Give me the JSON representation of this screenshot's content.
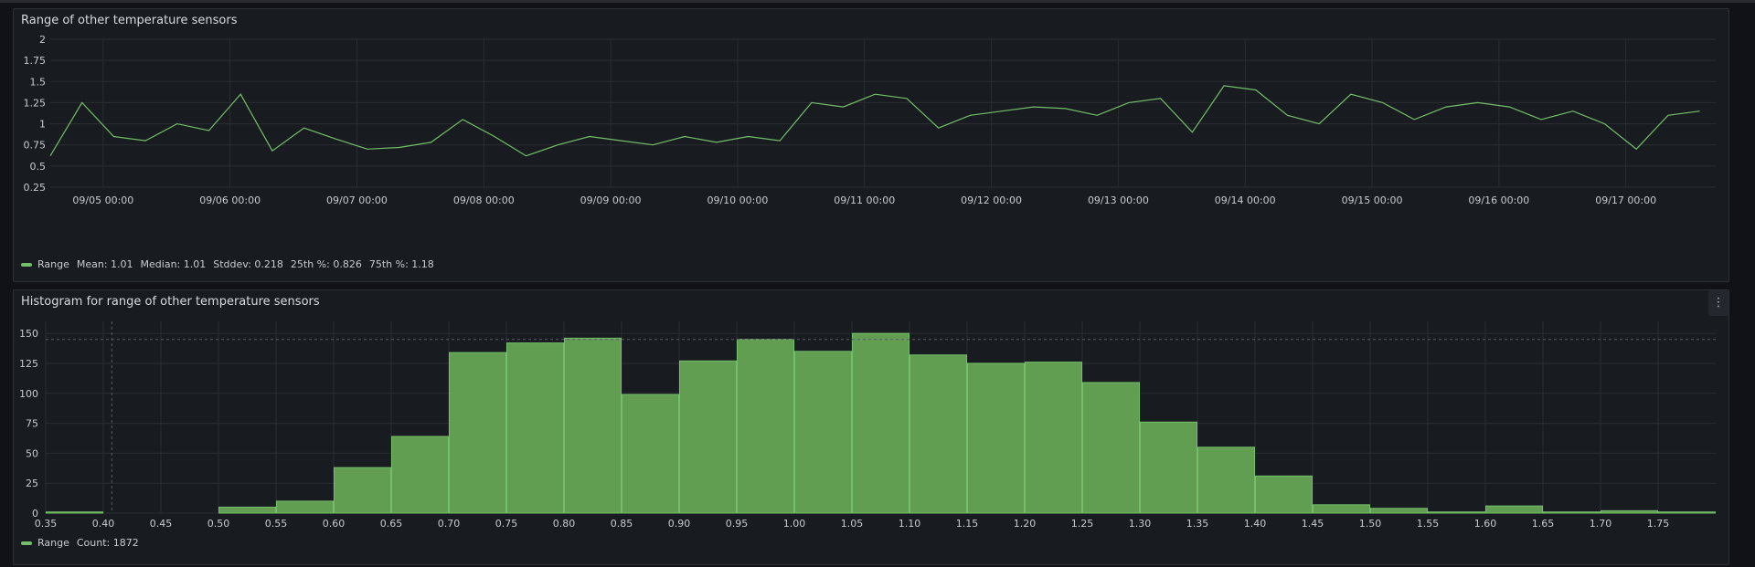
{
  "accent": "#73bf69",
  "panel1": {
    "title": "Range of other temperature sensors",
    "legend": {
      "series": "Range",
      "mean": "Mean: 1.01",
      "median": "Median: 1.01",
      "stddev": "Stddev: 0.218",
      "p25": "25th %: 0.826",
      "p75": "75th %: 1.18"
    }
  },
  "panel2": {
    "title": "Histogram for range of other temperature sensors",
    "menu_icon": "kebab-menu-icon",
    "legend": {
      "series": "Range",
      "count": "Count: 1872"
    }
  },
  "chart_data": [
    {
      "type": "line",
      "title": "Range of other temperature sensors",
      "series": [
        {
          "name": "Range",
          "x": [
            "09/04 14:00",
            "09/04 20:00",
            "09/05 02:00",
            "09/05 08:00",
            "09/05 14:00",
            "09/05 20:00",
            "09/06 02:00",
            "09/06 08:00",
            "09/06 14:00",
            "09/06 20:00",
            "09/07 02:00",
            "09/07 08:00",
            "09/07 14:00",
            "09/07 20:00",
            "09/08 02:00",
            "09/08 08:00",
            "09/08 14:00",
            "09/08 20:00",
            "09/09 02:00",
            "09/09 08:00",
            "09/09 14:00",
            "09/09 20:00",
            "09/10 02:00",
            "09/10 08:00",
            "09/10 14:00",
            "09/10 20:00",
            "09/11 02:00",
            "09/11 08:00",
            "09/11 14:00",
            "09/11 20:00",
            "09/12 02:00",
            "09/12 08:00",
            "09/12 14:00",
            "09/12 20:00",
            "09/13 02:00",
            "09/13 08:00",
            "09/13 14:00",
            "09/13 20:00",
            "09/14 02:00",
            "09/14 08:00",
            "09/14 14:00",
            "09/14 20:00",
            "09/15 02:00",
            "09/15 08:00",
            "09/15 14:00",
            "09/15 20:00",
            "09/16 02:00",
            "09/16 08:00",
            "09/16 14:00",
            "09/16 20:00",
            "09/17 02:00",
            "09/17 08:00",
            "09/17 14:00"
          ],
          "values": [
            0.62,
            1.25,
            0.85,
            0.8,
            1.0,
            0.92,
            1.35,
            0.68,
            0.95,
            0.82,
            0.7,
            0.72,
            0.78,
            1.05,
            0.85,
            0.62,
            0.75,
            0.85,
            0.8,
            0.75,
            0.85,
            0.78,
            0.85,
            0.8,
            1.25,
            1.2,
            1.35,
            1.3,
            0.95,
            1.1,
            1.15,
            1.2,
            1.18,
            1.1,
            1.25,
            1.3,
            0.9,
            1.45,
            1.4,
            1.1,
            1.0,
            1.35,
            1.25,
            1.05,
            1.2,
            1.25,
            1.2,
            1.05,
            1.15,
            1.0,
            0.7,
            1.1,
            1.15
          ]
        }
      ],
      "x_ticks": [
        "09/05 00:00",
        "09/06 00:00",
        "09/07 00:00",
        "09/08 00:00",
        "09/09 00:00",
        "09/10 00:00",
        "09/11 00:00",
        "09/12 00:00",
        "09/13 00:00",
        "09/14 00:00",
        "09/15 00:00",
        "09/16 00:00",
        "09/17 00:00"
      ],
      "y_ticks": [
        "0.25",
        "0.5",
        "0.75",
        "1",
        "1.25",
        "1.5",
        "1.75",
        "2"
      ],
      "ylim": [
        0.25,
        2
      ],
      "grid": true,
      "legend": "bottom-left"
    },
    {
      "type": "bar",
      "title": "Histogram for range of other temperature sensors",
      "categories": [
        "0.35",
        "0.40",
        "0.45",
        "0.50",
        "0.55",
        "0.60",
        "0.65",
        "0.70",
        "0.75",
        "0.80",
        "0.85",
        "0.90",
        "0.95",
        "1.00",
        "1.05",
        "1.10",
        "1.15",
        "1.20",
        "1.25",
        "1.30",
        "1.35",
        "1.40",
        "1.45",
        "1.50",
        "1.55",
        "1.60",
        "1.65",
        "1.70",
        "1.75"
      ],
      "series": [
        {
          "name": "Range",
          "values": [
            1,
            0,
            0,
            5,
            10,
            38,
            64,
            134,
            142,
            146,
            99,
            127,
            145,
            135,
            150,
            132,
            125,
            126,
            109,
            76,
            55,
            31,
            7,
            4,
            1,
            6,
            1,
            2,
            1
          ]
        }
      ],
      "x_ticks": [
        "0.35",
        "0.40",
        "0.45",
        "0.50",
        "0.55",
        "0.60",
        "0.65",
        "0.70",
        "0.75",
        "0.80",
        "0.85",
        "0.90",
        "0.95",
        "1.00",
        "1.05",
        "1.10",
        "1.15",
        "1.20",
        "1.25",
        "1.30",
        "1.35",
        "1.40",
        "1.45",
        "1.50",
        "1.55",
        "1.60",
        "1.65",
        "1.70",
        "1.75"
      ],
      "y_ticks": [
        "0",
        "25",
        "50",
        "75",
        "100",
        "125",
        "150"
      ],
      "ylim": [
        0,
        160
      ],
      "grid": true,
      "legend": "bottom-left"
    }
  ]
}
